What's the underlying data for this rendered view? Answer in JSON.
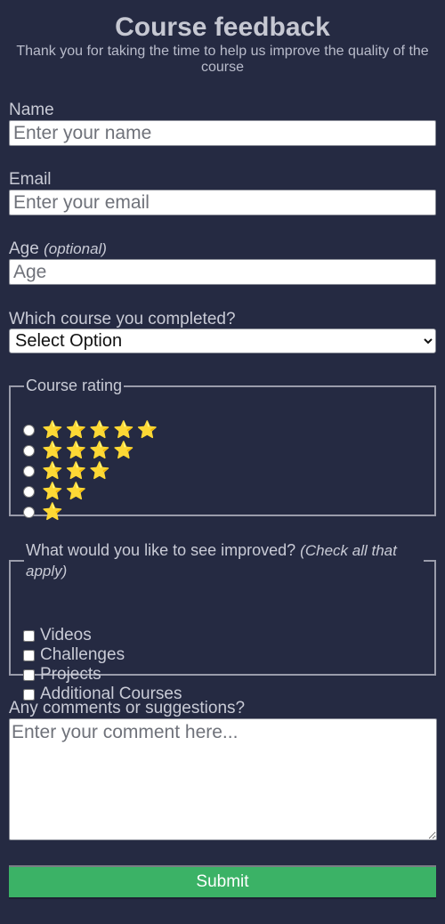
{
  "header": {
    "title": "Course feedback",
    "subtitle": "Thank you for taking the time to help us improve the quality of the course"
  },
  "fields": {
    "name": {
      "label": "Name",
      "placeholder": "Enter your name",
      "value": ""
    },
    "email": {
      "label": "Email",
      "placeholder": "Enter your email",
      "value": ""
    },
    "age": {
      "label": "Age",
      "optional_note": "(optional)",
      "placeholder": "Age",
      "value": ""
    },
    "course": {
      "label": "Which course you completed?",
      "selected": "Select Option"
    }
  },
  "rating": {
    "legend": "Course rating",
    "options": [
      {
        "stars": "⭐⭐⭐⭐⭐",
        "count": 5
      },
      {
        "stars": "⭐⭐⭐⭐",
        "count": 4
      },
      {
        "stars": "⭐⭐⭐",
        "count": 3
      },
      {
        "stars": "⭐⭐",
        "count": 2
      },
      {
        "stars": "⭐",
        "count": 1
      }
    ]
  },
  "improvements": {
    "legend": "What would you like to see improved?",
    "legend_note": "(Check all that apply)",
    "options": [
      "Videos",
      "Challenges",
      "Projects",
      "Additional Courses"
    ]
  },
  "comments": {
    "label": "Any comments or suggestions?",
    "placeholder": "Enter your comment here..."
  },
  "submit": {
    "label": "Submit"
  },
  "colors": {
    "background": "#252a42",
    "text": "#c9cbd6",
    "submit": "#3bb266",
    "star": "#f7c531"
  }
}
